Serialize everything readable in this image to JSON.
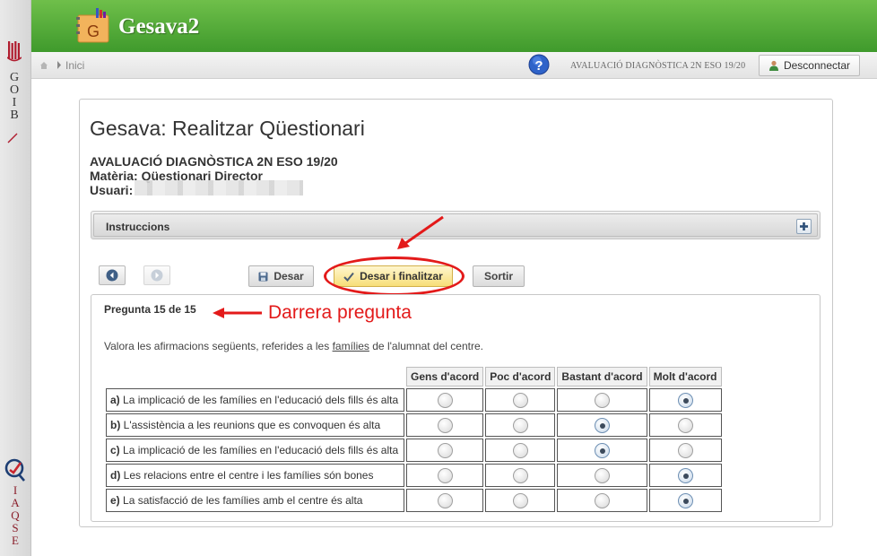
{
  "branding": {
    "goib_letters": [
      "G",
      "O",
      "I",
      "B"
    ],
    "iaqse_letters": [
      "I",
      "A",
      "Q",
      "S",
      "E"
    ],
    "app_logo_letter": "G",
    "app_title": "Gesava2"
  },
  "nav": {
    "breadcrumb": "Inici",
    "evaluation": "AVALUACIÓ DIAGNÒSTICA 2N ESO 19/20",
    "logout_label": "Desconnectar"
  },
  "page": {
    "title": "Gesava: Realitzar Qüestionari",
    "evaluation_line": "AVALUACIÓ DIAGNÒSTICA 2N ESO 19/20",
    "matter_line": "Matèria: Qüestionari Director",
    "user_label": "Usuari:"
  },
  "instructions": {
    "label": "Instruccions"
  },
  "toolbar": {
    "save_label": "Desar",
    "finish_label": "Desar i finalitzar",
    "exit_label": "Sortir"
  },
  "annotation": {
    "text": "Darrera pregunta"
  },
  "question": {
    "counter": "Pregunta 15 de 15",
    "statement_before": "Valora les afirmacions següents, referides a les ",
    "statement_underlined": "famílies",
    "statement_after": " de l'alumnat del centre.",
    "columns": [
      "Gens d'acord",
      "Poc d'acord",
      "Bastant d'acord",
      "Molt d'acord"
    ],
    "rows": [
      {
        "letter": "a)",
        "text": "La implicació de les famílies en l'educació dels fills és alta",
        "selected": 3
      },
      {
        "letter": "b)",
        "text": "L'assistència a les reunions que es convoquen és alta",
        "selected": 2
      },
      {
        "letter": "c)",
        "text": "La implicació de les famílies en l'educació dels fills és alta",
        "selected": 2
      },
      {
        "letter": "d)",
        "text": "Les relacions entre el centre i les famílies són bones",
        "selected": 3
      },
      {
        "letter": "e)",
        "text": "La satisfacció de les famílies amb el centre és alta",
        "selected": 3
      }
    ]
  },
  "colors": {
    "header_green": "#4caa33",
    "annotation_red": "#e31a1a",
    "finish_button": "#f7de78"
  },
  "icons": [
    "goib-logo-icon",
    "iaqse-logo-icon",
    "home-icon",
    "help-icon",
    "user-icon",
    "prev-icon",
    "next-icon",
    "save-icon",
    "check-icon",
    "plus-icon"
  ]
}
